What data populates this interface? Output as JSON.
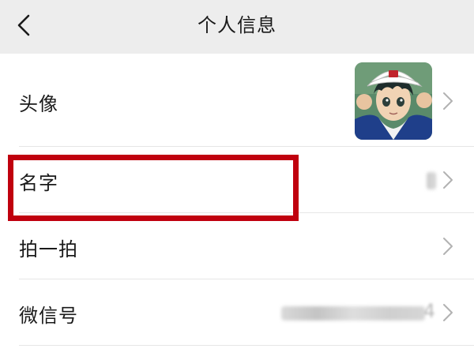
{
  "header": {
    "title": "个人信息",
    "back_icon": "chevron-left-icon"
  },
  "rows": [
    {
      "label": "头像",
      "type": "avatar"
    },
    {
      "label": "名字",
      "type": "blurred-value",
      "highlighted": true
    },
    {
      "label": "拍一拍",
      "type": "link"
    },
    {
      "label": "微信号",
      "type": "blurred-value",
      "value_tail": "4"
    }
  ],
  "colors": {
    "nav_background": "#ededed",
    "highlight_border": "#c0000e",
    "chevron": "#b2b2b2"
  }
}
